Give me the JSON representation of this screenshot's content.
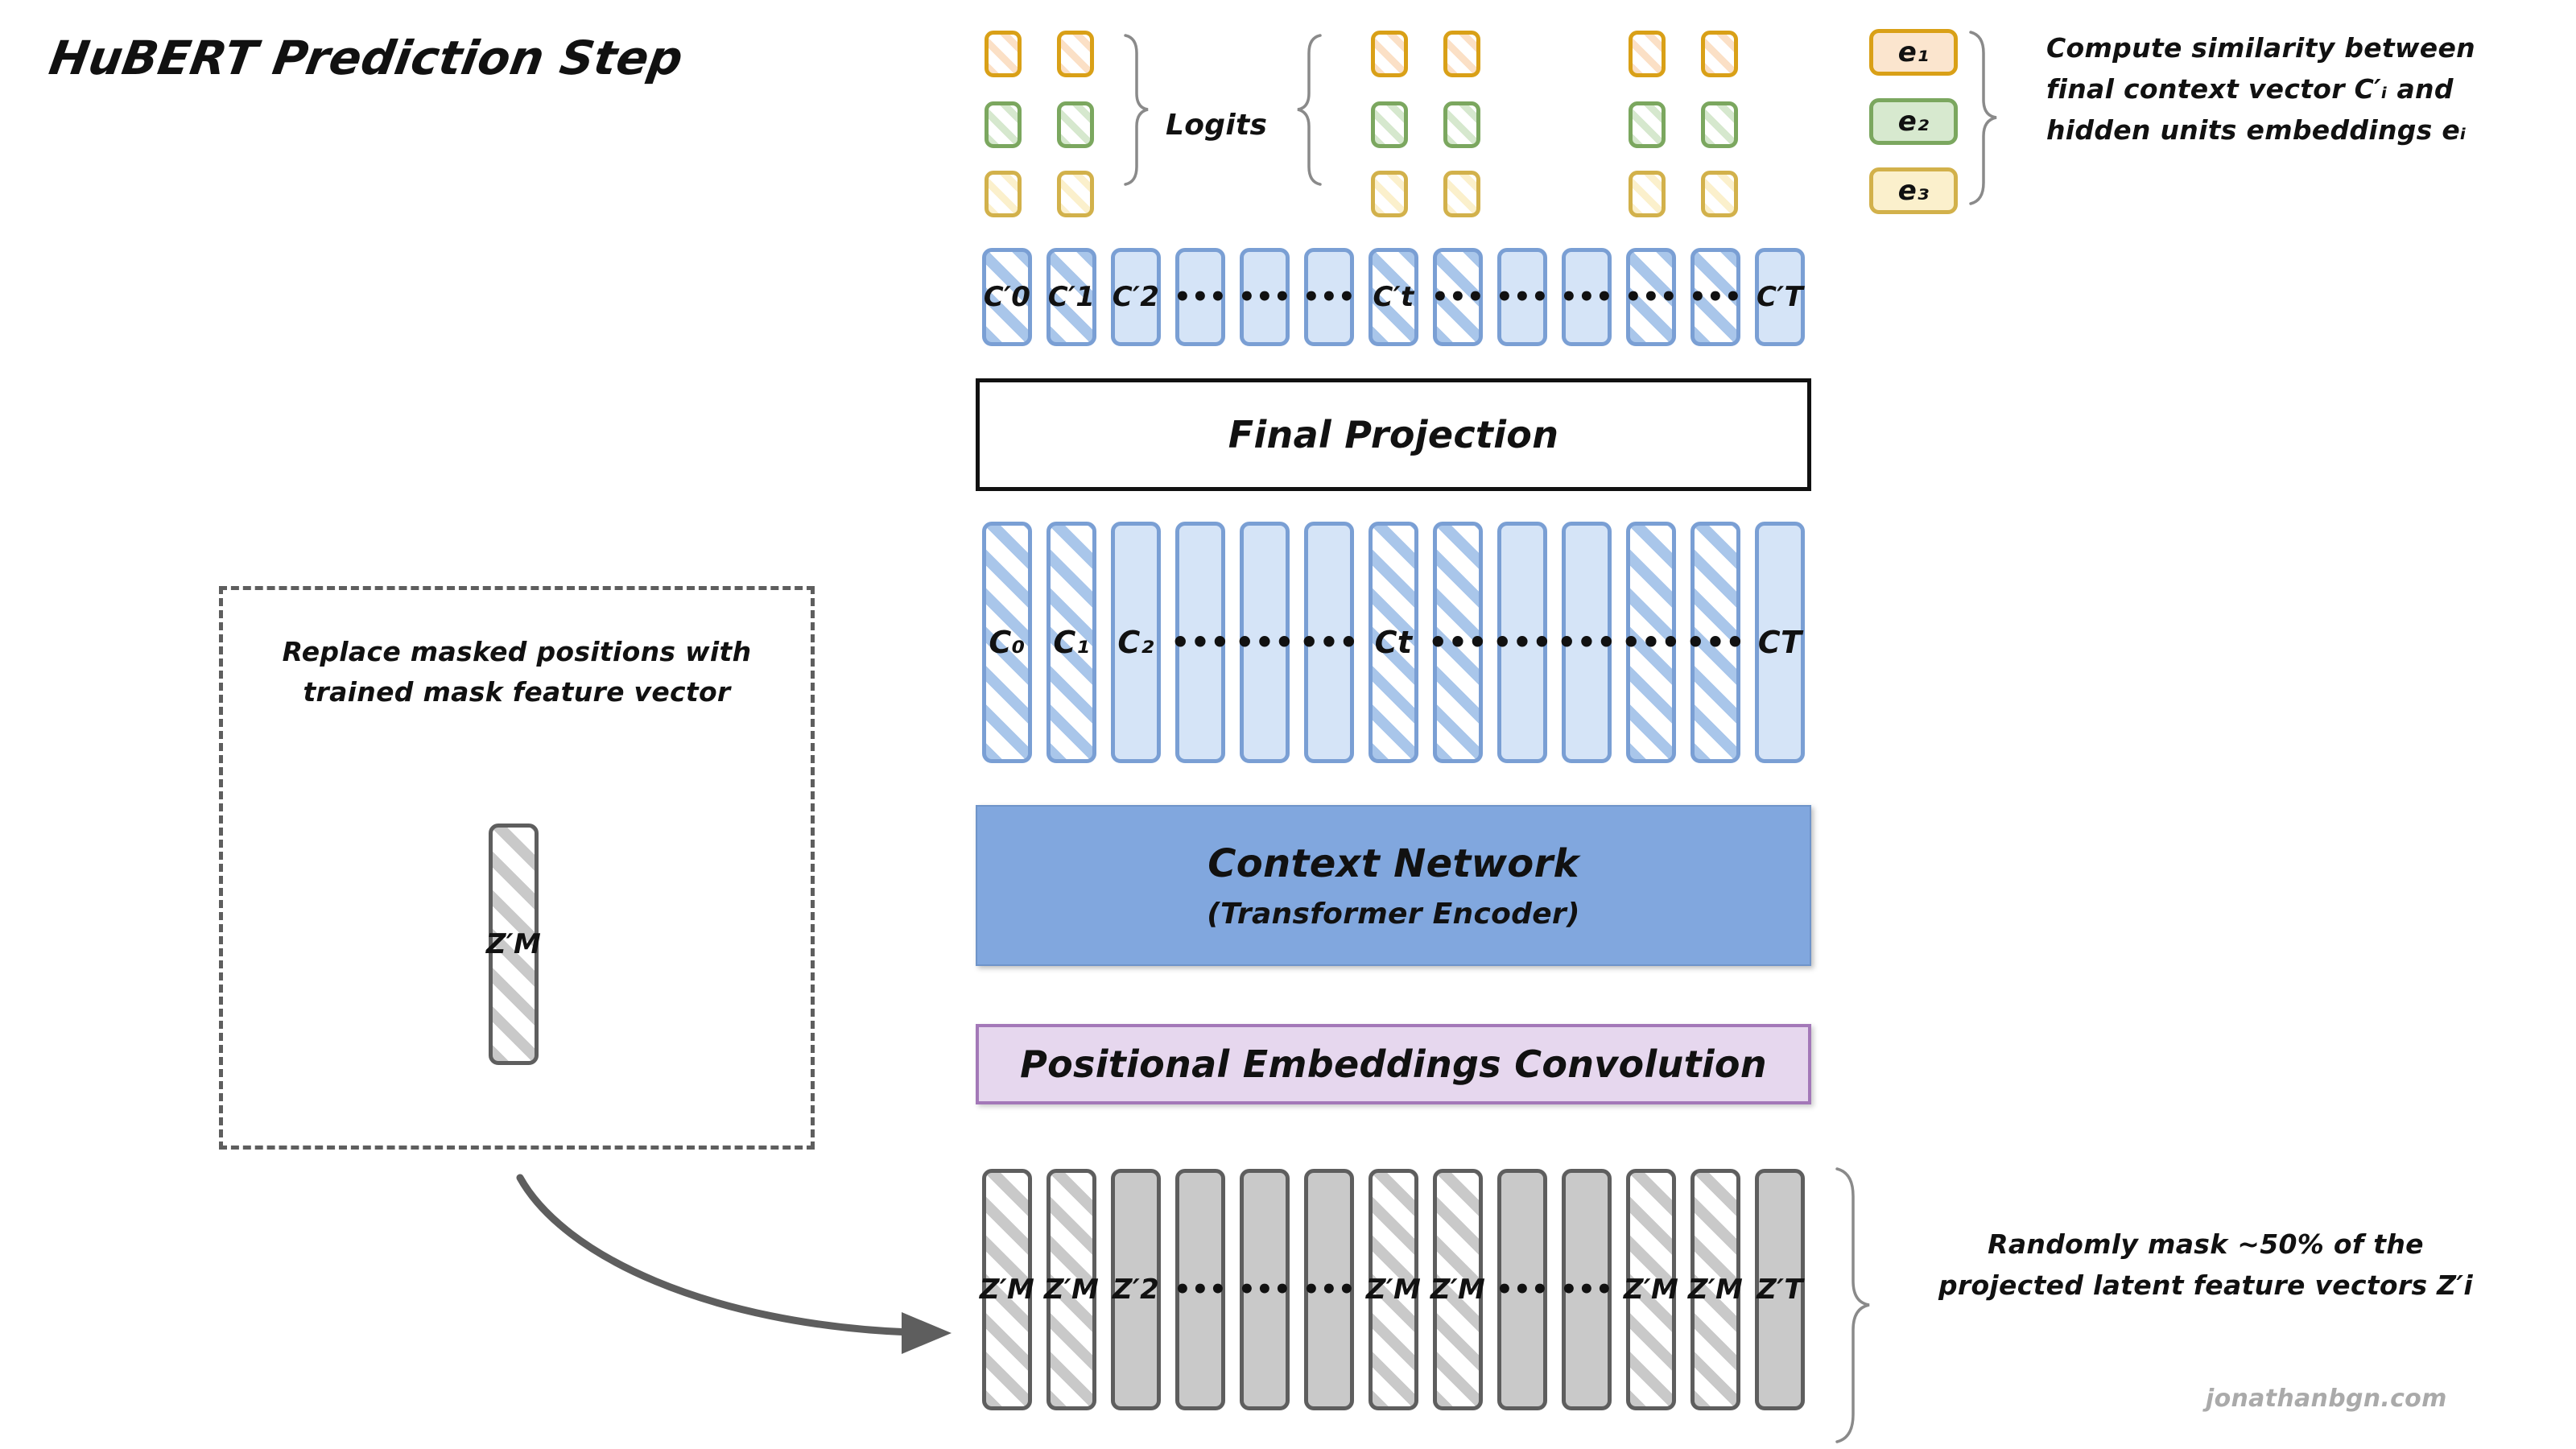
{
  "title": "HuBERT Prediction Step",
  "logits": {
    "label": "Logits",
    "row_colors": [
      "#d9a017",
      "#7ba75f",
      "#d2b14b"
    ],
    "groups": [
      [
        0,
        1
      ],
      [
        6,
        7
      ],
      [
        10,
        11
      ]
    ],
    "rows": 3
  },
  "embeddings": {
    "items": [
      {
        "label": "e₁",
        "color": "#d9a017",
        "fill": "#fbe5ce"
      },
      {
        "label": "e₂",
        "color": "#7ba75f",
        "fill": "#d7e9cf"
      },
      {
        "label": "e₃",
        "color": "#d2b14b",
        "fill": "#fbf0cc"
      }
    ],
    "note": [
      "Compute similarity between",
      "final context vector C′ᵢ and",
      "hidden units embeddings eᵢ"
    ]
  },
  "c_prime_row": {
    "labels": [
      "C′0",
      "C′1",
      "C′2",
      "•••",
      "•••",
      "•••",
      "C′t",
      "•••",
      "•••",
      "•••",
      "•••",
      "•••",
      "C′T"
    ],
    "masked": [
      true,
      true,
      false,
      false,
      false,
      false,
      true,
      true,
      false,
      false,
      true,
      true,
      false
    ],
    "color": "#7a9fd4",
    "fill": "#d5e4f7"
  },
  "final_projection": {
    "label": "Final Projection"
  },
  "c_row": {
    "labels": [
      "C₀",
      "C₁",
      "C₂",
      "•••",
      "•••",
      "•••",
      "Cₜ",
      "•••",
      "•••",
      "•••",
      "•••",
      "•••",
      "Cₜ"
    ],
    "labels_display": [
      "C₀",
      "C₁",
      "C₂",
      "•••",
      "•••",
      "•••",
      "Ct",
      "•••",
      "•••",
      "•••",
      "•••",
      "•••",
      "CT"
    ],
    "masked": [
      true,
      true,
      false,
      false,
      false,
      false,
      true,
      true,
      false,
      false,
      true,
      true,
      false
    ],
    "color": "#7a9fd4",
    "fill": "#d5e4f7"
  },
  "context_network": {
    "title": "Context Network",
    "subtitle": "(Transformer Encoder)",
    "color": "#81a7de"
  },
  "positional_embeddings": {
    "label": "Positional Embeddings Convolution",
    "color": "#e6d7ee"
  },
  "z_row": {
    "labels": [
      "Z′M",
      "Z′M",
      "Z′2",
      "•••",
      "•••",
      "•••",
      "Z′M",
      "Z′M",
      "•••",
      "•••",
      "Z′M",
      "Z′M",
      "Z′T"
    ],
    "masked": [
      true,
      true,
      false,
      false,
      false,
      false,
      true,
      true,
      false,
      false,
      true,
      true,
      false
    ],
    "color": "#5e5e5e",
    "fill": "#c9c9c9"
  },
  "mask_note": {
    "lines": [
      "Replace masked positions with",
      "trained mask feature vector"
    ],
    "box_label": "Z′M"
  },
  "random_mask_note": {
    "lines": [
      "Randomly mask ~50% of the",
      "projected latent feature vectors Z′i"
    ]
  },
  "watermark": {
    "text": "jonathanbgn.com"
  }
}
